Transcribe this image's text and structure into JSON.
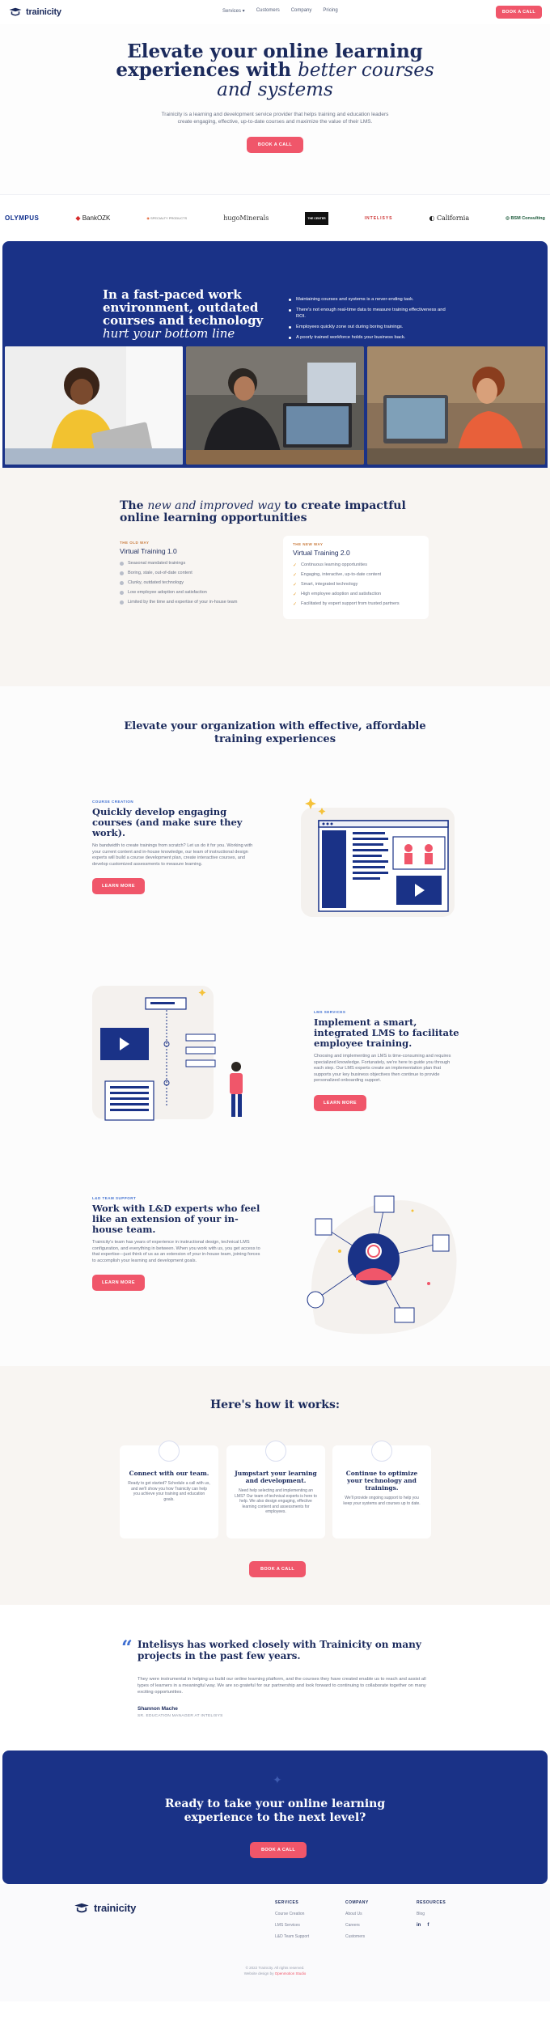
{
  "brand": {
    "name": "trainicity",
    "accent": "#f0566a",
    "navy": "#1a3287"
  },
  "nav": {
    "links": [
      "Services ▾",
      "Customers",
      "Company",
      "Pricing"
    ],
    "cta": "BOOK A CALL"
  },
  "hero": {
    "title_line1": "Elevate your online learning",
    "title_line2_a": "experiences with ",
    "title_line2_b": "better courses",
    "title_line3": "and systems",
    "body": "Trainicity is a learning and development service provider that helps training and education leaders create engaging, effective, up-to-date courses and maximize the value of their LMS.",
    "cta": "BOOK A CALL"
  },
  "clients": [
    "OLYMPUS",
    "BankOZK",
    "SPECIALTY PRODUCTS",
    "hugoMinerals",
    "THE CENTER",
    "INTELISYS",
    "California",
    "BSM Consulting"
  ],
  "problem": {
    "title_a": "In a fast-paced work environment, outdated courses and technology",
    "title_b": "hurt your bottom line",
    "bullets": [
      "Maintaining courses and systems is a never-ending task.",
      "There's not enough real-time data to measure training effectiveness and ROI.",
      "Employees quickly zone out during boring trainings.",
      "A poorly trained workforce holds your business back."
    ]
  },
  "compare": {
    "title_a": "The ",
    "title_b": "new and improved way",
    "title_c": " to create impactful online learning opportunities",
    "old_eyebrow": "THE OLD WAY",
    "old_title": "Virtual Training 1.0",
    "old_items": [
      "Seasonal mandated trainings",
      "Boring, stale, out-of-date content",
      "Clunky, outdated technology",
      "Low employee adoption and satisfaction",
      "Limited by the time and expertise of your in-house team"
    ],
    "new_eyebrow": "THE NEW WAY",
    "new_title": "Virtual Training 2.0",
    "new_items": [
      "Continuous learning opportunities",
      "Engaging, interactive, up-to-date content",
      "Smart, integrated technology",
      "High employee adoption and satisfaction",
      "Facilitated by expert support from trusted partners"
    ]
  },
  "features": {
    "title": "Elevate your organization with effective, affordable training experiences",
    "items": [
      {
        "eyebrow": "COURSE CREATION",
        "title": "Quickly develop engaging courses (and make sure they work).",
        "body": "No bandwidth to create trainings from scratch? Let us do it for you. Working with your current content and in-house knowledge, our team of instructional design experts will build a course development plan, create interactive courses, and develop customized assessments to measure learning.",
        "cta": "LEARN MORE"
      },
      {
        "eyebrow": "LMS SERVICES",
        "title": "Implement a smart, integrated LMS to facilitate employee training.",
        "body": "Choosing and implementing an LMS is time-consuming and requires specialized knowledge. Fortunately, we're here to guide you through each step. Our LMS experts create an implementation plan that supports your key business objectives then continue to provide personalized onboarding support.",
        "cta": "LEARN MORE"
      },
      {
        "eyebrow": "L&D TEAM SUPPORT",
        "title": "Work with L&D experts who feel like an extension of your in-house team.",
        "body": "Trainicity's team has years of experience in instructional design, technical LMS configuration, and everything in between. When you work with us, you get access to that expertise—just think of us as an extension of your in-house team, joining forces to accomplish your learning and development goals.",
        "cta": "LEARN MORE"
      }
    ]
  },
  "how": {
    "title": "Here's how it works:",
    "steps": [
      {
        "title": "Connect with our team.",
        "body": "Ready to get started? Schedule a call with us, and we'll show you how Trainicity can help you achieve your training and education goals."
      },
      {
        "title": "Jumpstart your learning and development.",
        "body": "Need help selecting and implementing an LMS? Our team of technical experts is here to help. We also design engaging, effective learning content and assessments for employees."
      },
      {
        "title": "Continue to optimize your technology and trainings.",
        "body": "We'll provide ongoing support to help you keep your systems and courses up to date."
      }
    ],
    "cta": "BOOK A CALL"
  },
  "testimonial": {
    "quote_mark": "“",
    "headline": "Intelisys has worked closely with Trainicity on many projects in the past few years.",
    "body": "They were instrumental in helping us build our online learning platform, and the courses they have created enable us to reach and assist all types of learners in a meaningful way. We are so grateful for our partnership and look forward to continuing to collaborate together on many exciting opportunities.",
    "name": "Shannon Mache",
    "role": "SR. EDUCATION MANAGER AT INTELISYS"
  },
  "cta": {
    "title": "Ready to take your online learning experience to the next level?",
    "button": "BOOK A CALL"
  },
  "footer": {
    "services_title": "SERVICES",
    "services": [
      "Course Creation",
      "LMS Services",
      "L&D Team Support"
    ],
    "company_title": "COMPANY",
    "company": [
      "About Us",
      "Careers",
      "Customers"
    ],
    "resources_title": "RESOURCES",
    "resources": [
      "Blog"
    ],
    "social": [
      "in",
      "f"
    ],
    "copyright": "© 2022 Trainicity. All rights reserved.",
    "credit_a": "Website design by ",
    "credit_b": "Openmotion Studio"
  }
}
